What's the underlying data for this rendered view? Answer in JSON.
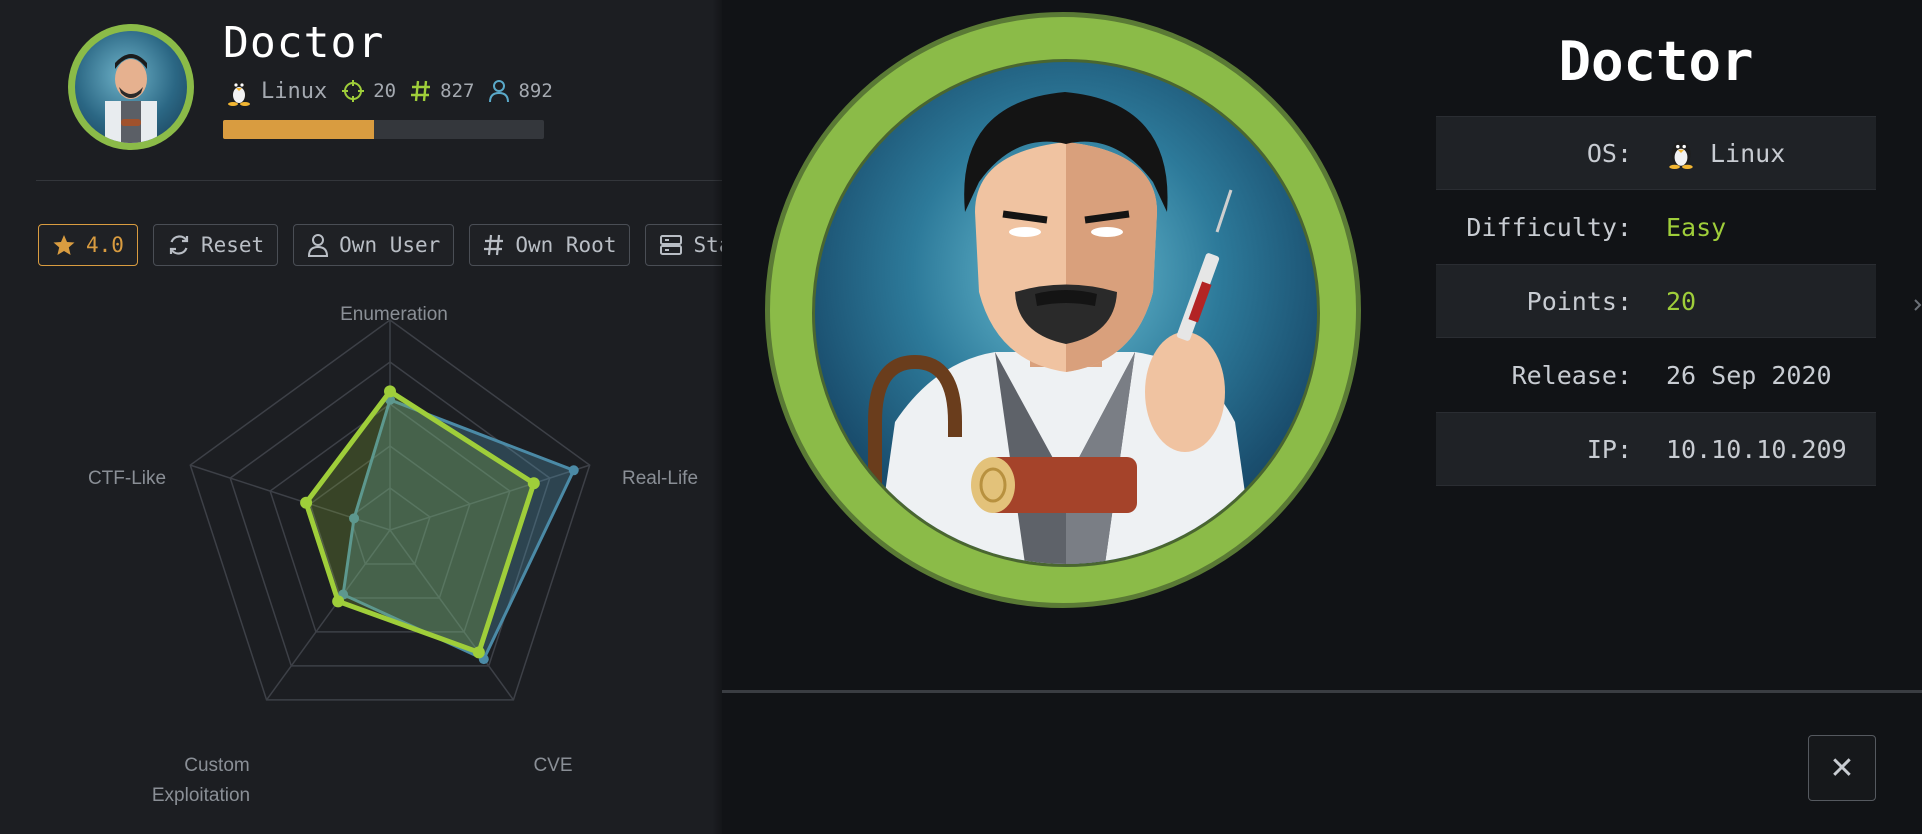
{
  "machine": {
    "name": "Doctor",
    "os": "Linux",
    "points": "20",
    "owns_root": "827",
    "owns_user": "892",
    "progress_pct": 47
  },
  "toolbar": {
    "rating": "4.0",
    "reset": "Reset",
    "own_user": "Own User",
    "own_root": "Own Root",
    "status": "Statu"
  },
  "radar": {
    "axes": [
      "Enumeration",
      "Real-Life",
      "CVE",
      "Custom",
      "Exploitation",
      "CTF-Like"
    ],
    "series": [
      {
        "values": [
          0.62,
          0.92,
          0.76,
          0.38,
          0.18
        ]
      },
      {
        "values": [
          0.66,
          0.72,
          0.72,
          0.42,
          0.42
        ]
      }
    ]
  },
  "details": {
    "title": "Doctor",
    "rows": [
      {
        "label": "OS:",
        "value": "Linux"
      },
      {
        "label": "Difficulty:",
        "value": "Easy"
      },
      {
        "label": "Points:",
        "value": "20"
      },
      {
        "label": "Release:",
        "value": "26 Sep 2020"
      },
      {
        "label": "IP:",
        "value": "10.10.10.209"
      }
    ]
  },
  "close_label": "✕",
  "colors": {
    "accent_green": "#9fce3a",
    "accent_orange": "#d99c40",
    "accent_blue": "#5aa9c9"
  },
  "icons": {
    "os": "tux-penguin-icon",
    "points": "crosshair-icon",
    "root": "hash-icon",
    "user": "user-icon"
  }
}
